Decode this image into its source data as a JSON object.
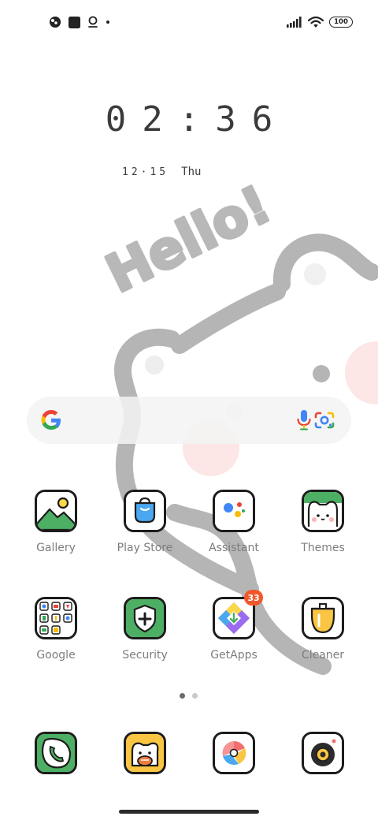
{
  "status_bar": {
    "left_icons": [
      "palette-icon",
      "square-icon",
      "location-icon",
      "dot-icon"
    ],
    "right_icons": [
      "signal-icon",
      "wifi-icon",
      "battery-icon"
    ],
    "battery_level": "100"
  },
  "wallpaper": {
    "text": "Hello!"
  },
  "clock": {
    "time": "02:36",
    "date": "12·15",
    "weekday": "Thu"
  },
  "search": {
    "icons": [
      "google-logo-icon",
      "microphone-icon",
      "google-lens-icon"
    ]
  },
  "apps": [
    {
      "label": "Gallery",
      "icon": "gallery-icon"
    },
    {
      "label": "Play Store",
      "icon": "play-store-icon"
    },
    {
      "label": "Assistant",
      "icon": "assistant-icon"
    },
    {
      "label": "Themes",
      "icon": "themes-icon"
    },
    {
      "label": "Google",
      "icon": "google-folder-icon"
    },
    {
      "label": "Security",
      "icon": "security-icon"
    },
    {
      "label": "GetApps",
      "icon": "getapps-icon",
      "badge": "33"
    },
    {
      "label": "Cleaner",
      "icon": "cleaner-icon"
    }
  ],
  "dock": [
    {
      "icon": "phone-icon"
    },
    {
      "icon": "messaging-icon"
    },
    {
      "icon": "browser-icon"
    },
    {
      "icon": "camera-icon"
    }
  ],
  "pager": {
    "pages": 2,
    "active": 1
  },
  "colors": {
    "accent_green": "#4caf63",
    "badge": "#f0582b",
    "wallpaper_gray": "#b5b5b5",
    "blush_pink": "#fde4e4"
  }
}
